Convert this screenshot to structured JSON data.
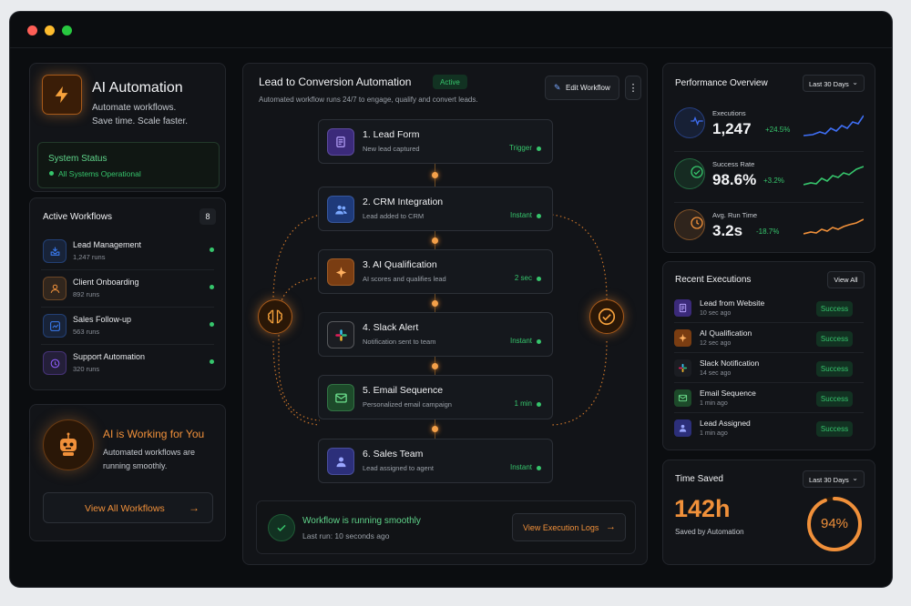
{
  "brand": {
    "title": "AI Automation",
    "tagline_1": "Automate workflows.",
    "tagline_2": "Save time. Scale faster."
  },
  "system_status": {
    "label": "System Status",
    "value": "All Systems Operational"
  },
  "active_workflows": {
    "title": "Active Workflows",
    "count": "8",
    "items": [
      {
        "name": "Lead Management",
        "runs": "1,247 runs",
        "icon": "inbox-icon",
        "color": "#3a7bf0"
      },
      {
        "name": "Client Onboarding",
        "runs": "892 runs",
        "icon": "user-icon",
        "color": "#e58b3a"
      },
      {
        "name": "Sales Follow-up",
        "runs": "563 runs",
        "icon": "chart-icon",
        "color": "#3a7bf0"
      },
      {
        "name": "Support Automation",
        "runs": "320 runs",
        "icon": "headset-icon",
        "color": "#8b5cf6"
      }
    ]
  },
  "ai_card": {
    "title": "AI is Working for You",
    "line_1": "Automated workflows are",
    "line_2": "running smoothly.",
    "button": "View All Workflows"
  },
  "workflow": {
    "title": "Lead to Conversion Automation",
    "status": "Active",
    "subtitle": "Automated workflow runs 24/7 to engage, qualify and convert leads.",
    "edit_button": "Edit Workflow",
    "steps": [
      {
        "title": "1. Lead Form",
        "sub": "New lead captured",
        "tag": "Trigger",
        "icon": "form-icon",
        "bg": "#3b2a7a",
        "fg": "#b9a4ff"
      },
      {
        "title": "2. CRM Integration",
        "sub": "Lead added to CRM",
        "tag": "Instant",
        "icon": "users-icon",
        "bg": "#1e3a7a",
        "fg": "#7aa8ff"
      },
      {
        "title": "3. AI Qualification",
        "sub": "AI scores and qualifies lead",
        "tag": "2 sec",
        "icon": "sparkle-icon",
        "bg": "#7a3d12",
        "fg": "#ffb060"
      },
      {
        "title": "4. Slack Alert",
        "sub": "Notification sent to team",
        "tag": "Instant",
        "icon": "slack-icon",
        "bg": "#1b1d22",
        "fg": "#ffffff"
      },
      {
        "title": "5. Email Sequence",
        "sub": "Personalized email campaign",
        "tag": "1 min",
        "icon": "mail-icon",
        "bg": "#1d4a2a",
        "fg": "#6ee38f"
      },
      {
        "title": "6. Sales Team",
        "sub": "Lead assigned to agent",
        "tag": "Instant",
        "icon": "person-icon",
        "bg": "#2c2f7a",
        "fg": "#9aa6ff"
      }
    ],
    "footer_status": "Workflow is running smoothly",
    "footer_last_run": "Last run: 10 seconds ago",
    "footer_button": "View Execution Logs"
  },
  "performance": {
    "title": "Performance Overview",
    "range": "Last 30 Days",
    "metrics": [
      {
        "label": "Executions",
        "value": "1,247",
        "change": "+24.5%",
        "color": "#3f6ff5",
        "icon": "pulse-icon"
      },
      {
        "label": "Success Rate",
        "value": "98.6%",
        "change": "+3.2%",
        "color": "#36c56c",
        "icon": "check-circle-icon"
      },
      {
        "label": "Avg. Run Time",
        "value": "3.2s",
        "change": "-18.7%",
        "color": "#f0903a",
        "icon": "clock-icon"
      }
    ]
  },
  "recent": {
    "title": "Recent Executions",
    "view_all": "View All",
    "items": [
      {
        "name": "Lead from Website",
        "time": "10 sec ago",
        "status": "Success",
        "bg": "#3b2a7a",
        "fg": "#b9a4ff"
      },
      {
        "name": "AI Qualification",
        "time": "12 sec ago",
        "status": "Success",
        "bg": "#7a3d12",
        "fg": "#ffb060"
      },
      {
        "name": "Slack Notification",
        "time": "14 sec ago",
        "status": "Success",
        "bg": "#1b1d22",
        "fg": "#ffffff"
      },
      {
        "name": "Email Sequence",
        "time": "1 min ago",
        "status": "Success",
        "bg": "#1d4a2a",
        "fg": "#6ee38f"
      },
      {
        "name": "Lead Assigned",
        "time": "1 min ago",
        "status": "Success",
        "bg": "#2c2f7a",
        "fg": "#9aa6ff"
      }
    ]
  },
  "time_saved": {
    "title": "Time Saved",
    "range": "Last 30 Days",
    "value": "142h",
    "sub": "Saved by Automation",
    "percent_label": "94%",
    "percent": 0.94
  }
}
